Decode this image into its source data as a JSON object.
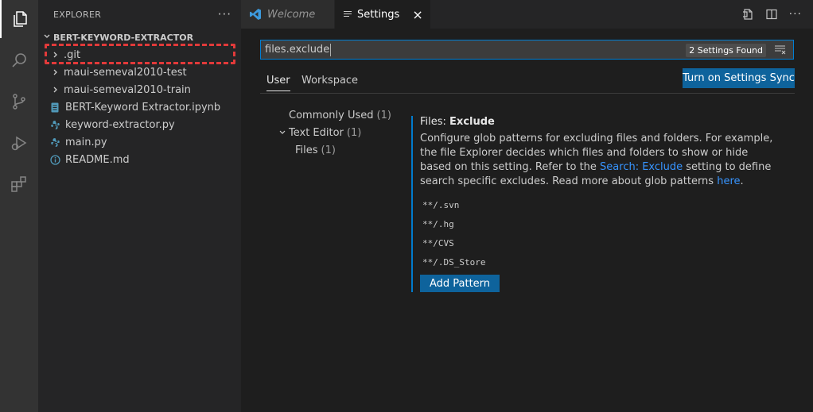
{
  "activity_bar": {
    "items": [
      "explorer-icon",
      "search-icon",
      "source-control-icon",
      "run-debug-icon",
      "extensions-icon"
    ]
  },
  "explorer": {
    "title": "EXPLORER",
    "more": "···",
    "folder": "BERT-KEYWORD-EXTRACTOR",
    "items": [
      {
        "label": ".git",
        "kind": "folder"
      },
      {
        "label": "maui-semeval2010-test",
        "kind": "folder"
      },
      {
        "label": "maui-semeval2010-train",
        "kind": "folder"
      },
      {
        "label": "BERT-Keyword Extractor.ipynb",
        "kind": "notebook"
      },
      {
        "label": "keyword-extractor.py",
        "kind": "python"
      },
      {
        "label": "main.py",
        "kind": "python"
      },
      {
        "label": "README.md",
        "kind": "info"
      }
    ]
  },
  "tabs": [
    {
      "label": "Welcome",
      "icon": "vscode-icon"
    },
    {
      "label": "Settings",
      "icon": "settings-list-icon",
      "close": "×"
    }
  ],
  "settings": {
    "search_value": "files.exclude",
    "found_badge": "2 Settings Found",
    "scope_tabs": [
      "User",
      "Workspace"
    ],
    "sync_button": "Turn on Settings Sync",
    "toc": [
      {
        "label": "Commonly Used",
        "count": "(1)"
      },
      {
        "label": "Text Editor",
        "count": "(1)"
      },
      {
        "label": "Files",
        "count": "(1)"
      }
    ],
    "setting": {
      "category": "Files: ",
      "name": "Exclude",
      "desc_1": "Configure glob patterns for excluding files and folders. For example, the file Explorer decides which files and folders to show or hide based on this setting. Refer to the ",
      "link_1": "Search: Exclude",
      "desc_2": " setting to define search specific excludes. Read more about glob patterns ",
      "link_2": "here",
      "desc_3": ".",
      "patterns": [
        "**/.svn",
        "**/.hg",
        "**/CVS",
        "**/.DS_Store"
      ],
      "add_button": "Add Pattern"
    }
  },
  "colors": {
    "accent": "#007acc",
    "button": "#0e639c",
    "link": "#3794ff",
    "highlight": "#e23a3a"
  }
}
